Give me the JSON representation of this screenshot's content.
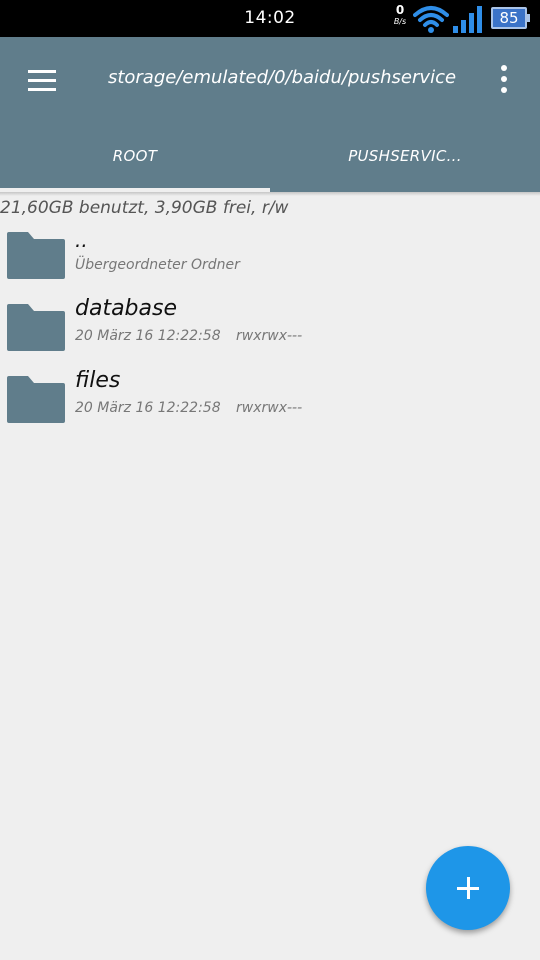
{
  "status_bar": {
    "time": "14:02",
    "net_speed_value": "0",
    "net_speed_unit": "B/s",
    "battery": "85"
  },
  "app_bar": {
    "path": "storage/emulated/0/baidu/pushservice",
    "tabs": [
      {
        "label": "ROOT",
        "active": true
      },
      {
        "label": "PUSHSERVIC..."
      }
    ]
  },
  "storage_info": "21,60GB benutzt, 3,90GB frei, r/w",
  "files": [
    {
      "name": "..",
      "subtitle": "Übergeordneter Ordner",
      "permissions": ""
    },
    {
      "name": "database",
      "subtitle": "20 März 16 12:22:58",
      "permissions": "rwxrwx---"
    },
    {
      "name": "files",
      "subtitle": "20 März 16 12:22:58",
      "permissions": "rwxrwx---"
    }
  ],
  "colors": {
    "app_bar": "#607d8b",
    "folder": "#607d8b",
    "fab": "#1e96e8",
    "background": "#efefef"
  }
}
